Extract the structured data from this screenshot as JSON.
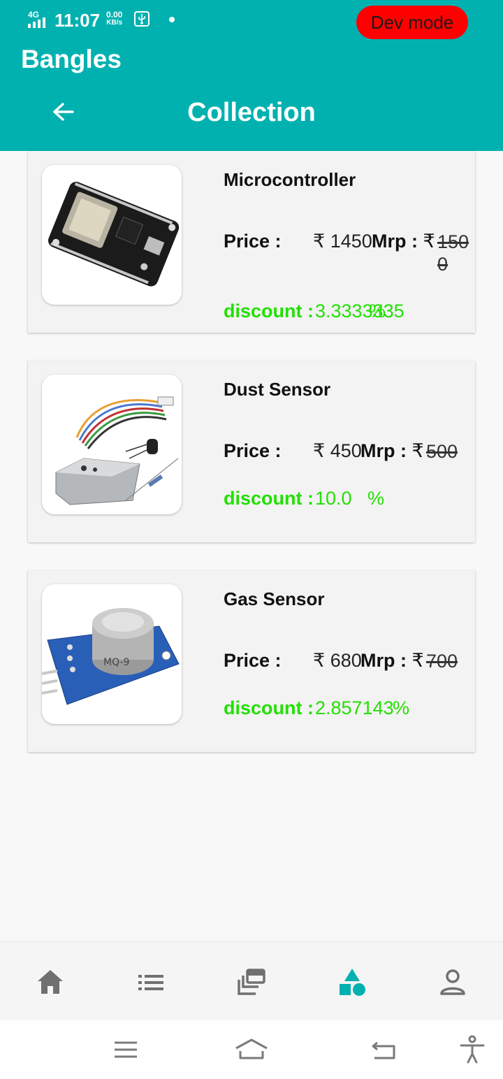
{
  "status_bar": {
    "network": "4G",
    "time": "11:07",
    "speed_value": "0.00",
    "speed_unit": "KB/s"
  },
  "dev_badge": "Dev mode",
  "header": {
    "app_title": "Bangles",
    "page_title": "Collection"
  },
  "labels": {
    "price": "Price :",
    "mrp": "Mrp :",
    "discount": "discount :",
    "currency": "₹"
  },
  "products": [
    {
      "name": "Microcontroller",
      "price": "1450",
      "mrp": "1500",
      "discount": "3.3333335",
      "discount_pct": "%"
    },
    {
      "name": "Dust Sensor",
      "price": "450",
      "mrp": "500",
      "discount": "10.0",
      "discount_pct": "%"
    },
    {
      "name": "Gas Sensor",
      "price": "680",
      "mrp": "700",
      "discount": "2.857143",
      "discount_pct": "%"
    }
  ],
  "bottom_nav": {
    "items": [
      "home-icon",
      "list-icon",
      "collections-icon",
      "categories-icon",
      "account-icon"
    ],
    "active_index": 3,
    "active_color": "#00b1b0",
    "inactive_color": "#707070"
  },
  "colors": {
    "primary": "#00b1b0",
    "discount": "#22e000",
    "dev_badge": "#ff0000"
  }
}
